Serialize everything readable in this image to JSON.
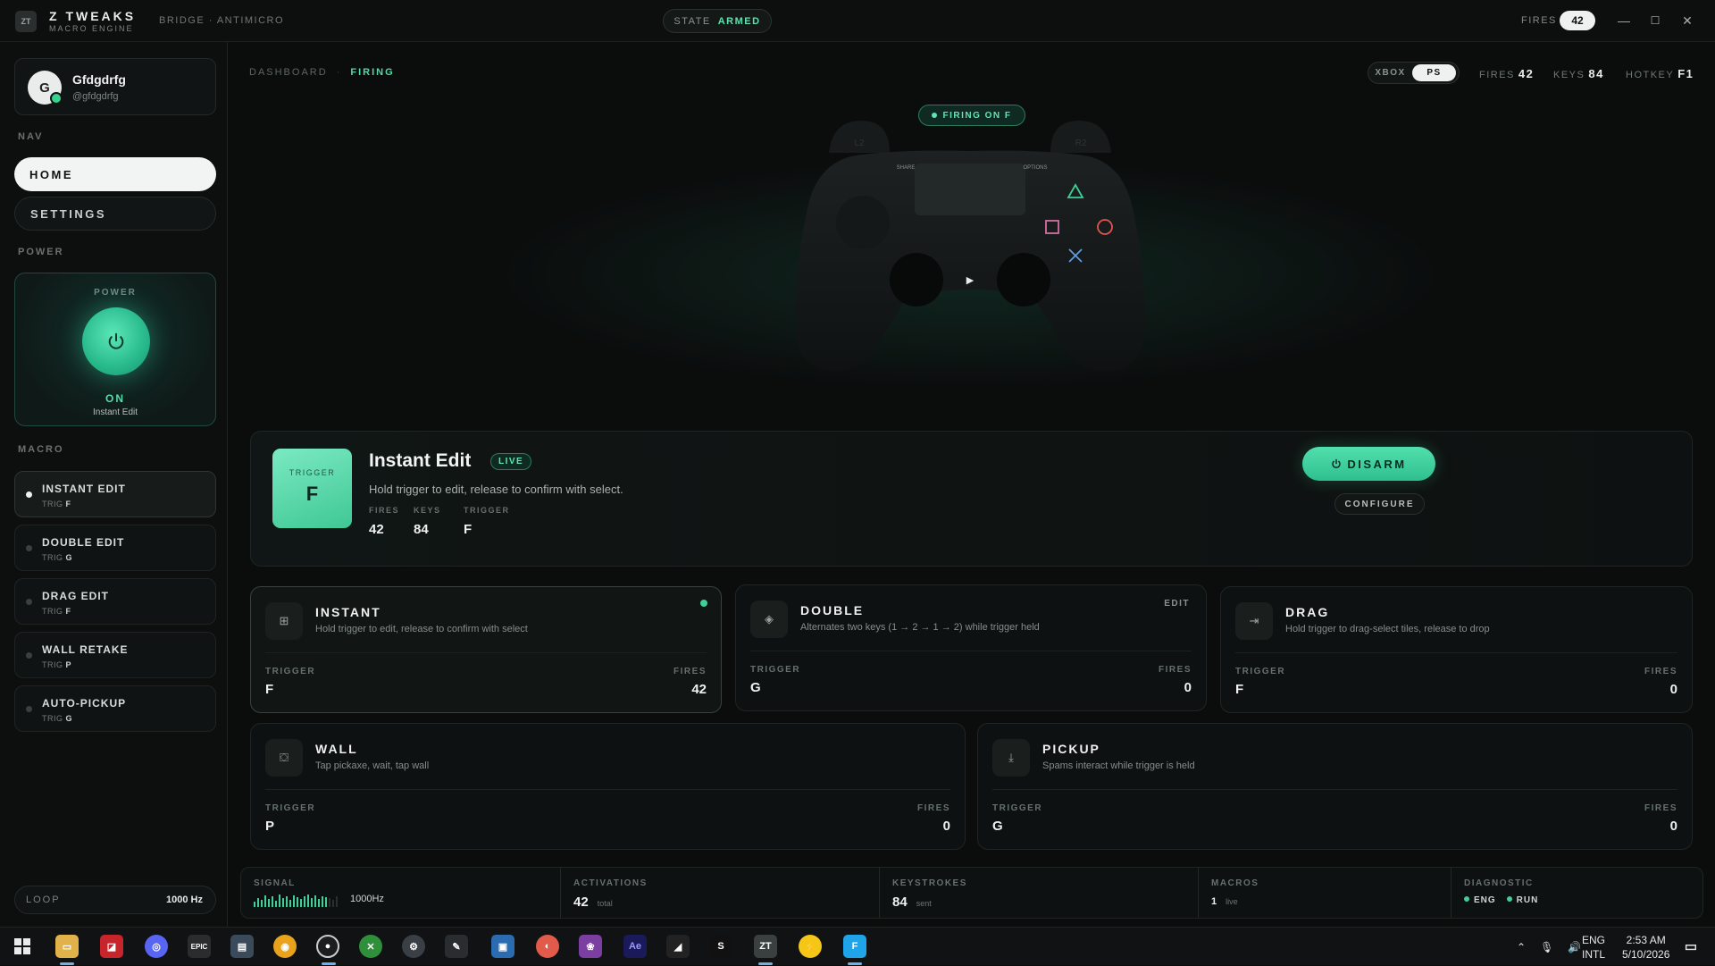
{
  "app": {
    "logo": "ZT",
    "name": "Z TWEAKS",
    "subtitle": "MACRO ENGINE",
    "bridge": "BRIDGE · ANTIMICRO",
    "state_label": "STATE",
    "state_value": "ARMED",
    "fires_label": "FIRES",
    "fires_value": "42",
    "window_controls": [
      "—",
      "☐",
      "✕"
    ]
  },
  "sidebar": {
    "profile": {
      "initial": "G",
      "name": "Gfdgdrfg",
      "handle": "@gfdgdrfg"
    },
    "nav_label": "NAV",
    "nav": [
      {
        "label": "HOME",
        "active": true
      },
      {
        "label": "SETTINGS",
        "active": false
      }
    ],
    "power_section_label": "POWER",
    "power": {
      "title": "POWER",
      "state": "ON",
      "macro": "Instant Edit"
    },
    "macro_section_label": "MACRO",
    "macros": [
      {
        "name": "INSTANT EDIT",
        "trig_label": "TRIG",
        "trig": "F",
        "active": true
      },
      {
        "name": "DOUBLE EDIT",
        "trig_label": "TRIG",
        "trig": "G",
        "active": false
      },
      {
        "name": "DRAG EDIT",
        "trig_label": "TRIG",
        "trig": "F",
        "active": false
      },
      {
        "name": "WALL RETAKE",
        "trig_label": "TRIG",
        "trig": "P",
        "active": false
      },
      {
        "name": "AUTO-PICKUP",
        "trig_label": "TRIG",
        "trig": "G",
        "active": false
      }
    ],
    "loop": {
      "label": "LOOP",
      "value": "1000 Hz"
    }
  },
  "header": {
    "breadcrumb": [
      "DASHBOARD",
      "FIRING"
    ],
    "platforms": [
      "XBOX",
      "PS"
    ],
    "platform_selected": "PS",
    "stats": [
      {
        "label": "FIRES",
        "value": "42"
      },
      {
        "label": "KEYS",
        "value": "84"
      },
      {
        "label": "HOTKEY",
        "value": "F1"
      }
    ]
  },
  "controller": {
    "status": "FIRING ON F",
    "l2": "L2",
    "r2": "R2",
    "share": "SHARE",
    "options": "OPTIONS",
    "colors": {
      "triangle": "#3fcf97",
      "square": "#d46fa3",
      "circle": "#e2544f",
      "cross": "#5f9de0"
    }
  },
  "hero": {
    "trigger_label": "TRIGGER",
    "trigger_key": "F",
    "title": "Instant Edit",
    "badge": "LIVE",
    "description": "Hold trigger to edit, release to confirm with select.",
    "stats": [
      {
        "label": "FIRES",
        "value": "42"
      },
      {
        "label": "KEYS",
        "value": "84"
      },
      {
        "label": "TRIGGER",
        "value": "F"
      }
    ],
    "disarm_label": "DISARM",
    "configure_label": "CONFIGURE"
  },
  "cards": [
    {
      "icon": "grid-icon",
      "glyph": "⊞",
      "title": "INSTANT",
      "desc": "Hold trigger to edit, release to confirm with select",
      "trigger_label": "TRIGGER",
      "trigger": "F",
      "fires_label": "FIRES",
      "fires": "42",
      "live": true
    },
    {
      "icon": "layers-icon",
      "glyph": "◈",
      "title": "DOUBLE",
      "desc": "Alternates two keys (1 → 2 → 1 → 2) while trigger held",
      "trigger_label": "TRIGGER",
      "trigger": "G",
      "fires_label": "FIRES",
      "fires": "0",
      "edit_label": "EDIT"
    },
    {
      "icon": "drag-arrow-icon",
      "glyph": "⇥",
      "title": "DRAG",
      "desc": "Hold trigger to drag-select tiles, release to drop",
      "trigger_label": "TRIGGER",
      "trigger": "F",
      "fires_label": "FIRES",
      "fires": "0"
    },
    {
      "icon": "wall-icon",
      "glyph": "⛋",
      "title": "WALL",
      "desc": "Tap pickaxe, wait, tap wall",
      "trigger_label": "TRIGGER",
      "trigger": "P",
      "fires_label": "FIRES",
      "fires": "0"
    },
    {
      "icon": "download-icon",
      "glyph": "⤓",
      "title": "PICKUP",
      "desc": "Spams interact while trigger is held",
      "trigger_label": "TRIGGER",
      "trigger": "G",
      "fires_label": "FIRES",
      "fires": "0"
    }
  ],
  "strip": {
    "signal": {
      "label": "SIGNAL",
      "value": "1000Hz"
    },
    "activations": {
      "label": "ACTIVATIONS",
      "value": "42",
      "unit": "total"
    },
    "keystrokes": {
      "label": "KEYSTROKES",
      "value": "84",
      "unit": "sent"
    },
    "macros": {
      "label": "MACROS",
      "value": "1",
      "unit": "live"
    },
    "diagnostic": {
      "label": "DIAGNOSTIC",
      "items": [
        "ENG",
        "RUN"
      ]
    }
  },
  "taskbar": {
    "lang_line1": "ENG",
    "lang_line2": "INTL",
    "time": "2:53 AM",
    "date": "5/10/2026"
  }
}
